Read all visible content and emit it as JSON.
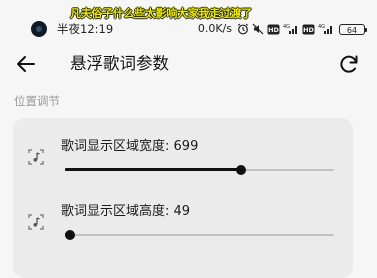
{
  "overlay": {
    "lyric": "凡夫俗子什么些太影响大家我走过渡了"
  },
  "status_bar": {
    "time": "半夜12:19",
    "net_speed": "0.0K/s",
    "battery": "64"
  },
  "header": {
    "title": "悬浮歌词参数"
  },
  "section": {
    "label": "位置调节"
  },
  "settings": [
    {
      "label": "歌词显示区域宽度",
      "value": "699",
      "fraction": 0.655
    },
    {
      "label": "歌词显示区域高度",
      "value": "49",
      "fraction": 0.019
    }
  ]
}
